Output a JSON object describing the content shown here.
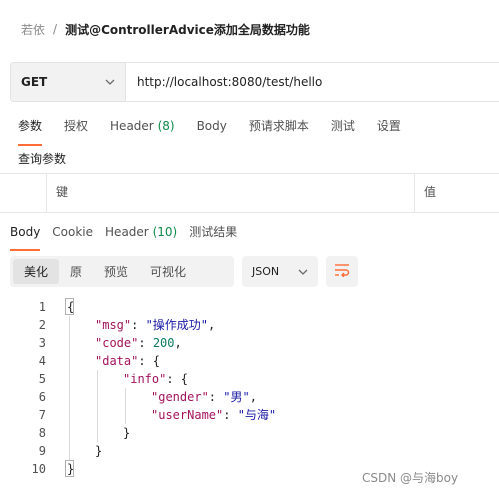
{
  "breadcrumb": {
    "parent": "若依",
    "separator": "/",
    "current": "测试@ControllerAdvice添加全局数据功能"
  },
  "request": {
    "method": "GET",
    "url": "http://localhost:8080/test/hello"
  },
  "request_tabs": [
    {
      "label": "参数",
      "active": true
    },
    {
      "label": "授权"
    },
    {
      "label": "Header",
      "count": "(8)"
    },
    {
      "label": "Body"
    },
    {
      "label": "预请求脚本"
    },
    {
      "label": "测试"
    },
    {
      "label": "设置"
    }
  ],
  "params": {
    "title": "查询参数",
    "key_header": "键",
    "value_header": "值"
  },
  "response_tabs": [
    {
      "label": "Body",
      "active": true
    },
    {
      "label": "Cookie"
    },
    {
      "label": "Header",
      "count": "(10)"
    },
    {
      "label": "测试结果"
    }
  ],
  "view_modes": [
    "美化",
    "原",
    "预览",
    "可视化"
  ],
  "active_view_mode": "美化",
  "format": "JSON",
  "code_lines": [
    {
      "n": "1",
      "tokens": [
        {
          "t": "{",
          "c": "punct"
        }
      ]
    },
    {
      "n": "2",
      "tokens": [
        {
          "t": "\"msg\"",
          "c": "key"
        },
        {
          "t": ": ",
          "c": "punct"
        },
        {
          "t": "\"操作成功\"",
          "c": "str"
        },
        {
          "t": ",",
          "c": "punct"
        }
      ]
    },
    {
      "n": "3",
      "tokens": [
        {
          "t": "\"code\"",
          "c": "key"
        },
        {
          "t": ": ",
          "c": "punct"
        },
        {
          "t": "200",
          "c": "num"
        },
        {
          "t": ",",
          "c": "punct"
        }
      ]
    },
    {
      "n": "4",
      "tokens": [
        {
          "t": "\"data\"",
          "c": "key"
        },
        {
          "t": ": {",
          "c": "punct"
        }
      ]
    },
    {
      "n": "5",
      "tokens": [
        {
          "t": "\"info\"",
          "c": "key"
        },
        {
          "t": ": {",
          "c": "punct"
        }
      ]
    },
    {
      "n": "6",
      "tokens": [
        {
          "t": "\"gender\"",
          "c": "key"
        },
        {
          "t": ": ",
          "c": "punct"
        },
        {
          "t": "\"男\"",
          "c": "str"
        },
        {
          "t": ",",
          "c": "punct"
        }
      ]
    },
    {
      "n": "7",
      "tokens": [
        {
          "t": "\"userName\"",
          "c": "key"
        },
        {
          "t": ": ",
          "c": "punct"
        },
        {
          "t": "\"与海\"",
          "c": "str"
        }
      ]
    },
    {
      "n": "8",
      "tokens": [
        {
          "t": "}",
          "c": "punct"
        }
      ]
    },
    {
      "n": "9",
      "tokens": [
        {
          "t": "}",
          "c": "punct"
        }
      ]
    },
    {
      "n": "10",
      "tokens": [
        {
          "t": "}",
          "c": "punct"
        }
      ]
    }
  ],
  "watermark": "CSDN @与海boy",
  "colors": {
    "accent": "#ff6c37",
    "count_green": "#0f8a4a",
    "json_key": "#a3125c",
    "json_string": "#1a1aa6",
    "json_number": "#0b7a5b"
  },
  "icons": {
    "method_dropdown": "chevron-down-icon",
    "format_dropdown": "chevron-down-icon",
    "wrap": "wrap-lines-icon"
  }
}
